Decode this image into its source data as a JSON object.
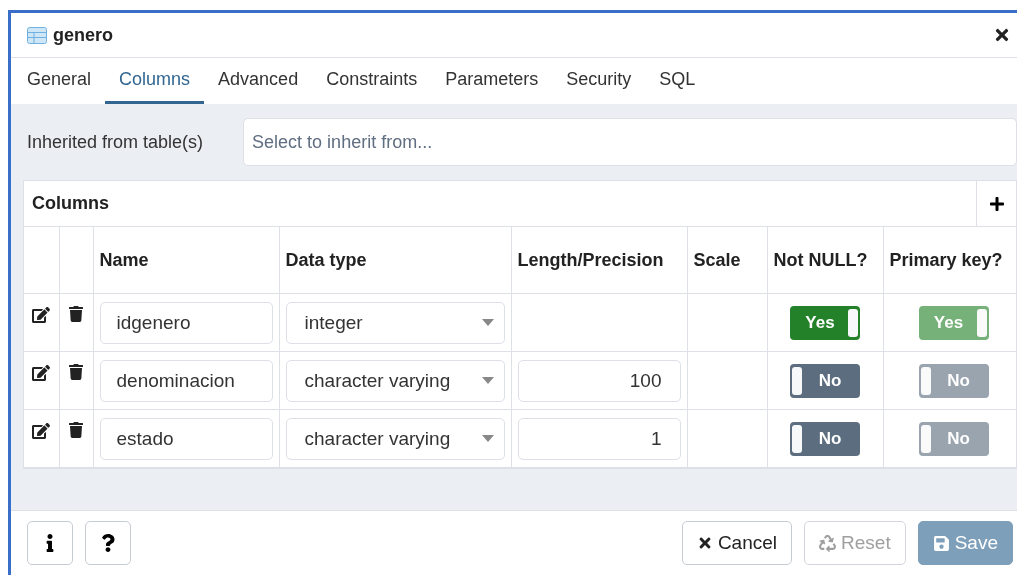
{
  "window": {
    "title": "genero"
  },
  "tabs": [
    {
      "label": "General",
      "selected": false
    },
    {
      "label": "Columns",
      "selected": true
    },
    {
      "label": "Advanced",
      "selected": false
    },
    {
      "label": "Constraints",
      "selected": false
    },
    {
      "label": "Parameters",
      "selected": false
    },
    {
      "label": "Security",
      "selected": false
    },
    {
      "label": "SQL",
      "selected": false
    }
  ],
  "inherit": {
    "label": "Inherited from table(s)",
    "placeholder": "Select to inherit from..."
  },
  "columns_panel": {
    "title": "Columns",
    "headers": [
      "Name",
      "Data type",
      "Length/Precision",
      "Scale",
      "Not NULL?",
      "Primary key?"
    ],
    "rows": [
      {
        "name": "idgenero",
        "data_type": "integer",
        "length": null,
        "not_null": {
          "on": true,
          "label": "Yes",
          "disabled": false
        },
        "primary_key": {
          "on": true,
          "label": "Yes",
          "disabled": true
        }
      },
      {
        "name": "denominacion",
        "data_type": "character varying",
        "length": "100",
        "not_null": {
          "on": false,
          "label": "No",
          "disabled": false
        },
        "primary_key": {
          "on": false,
          "label": "No",
          "disabled": true
        }
      },
      {
        "name": "estado",
        "data_type": "character varying",
        "length": "1",
        "not_null": {
          "on": false,
          "label": "No",
          "disabled": false
        },
        "primary_key": {
          "on": false,
          "label": "No",
          "disabled": true
        }
      }
    ]
  },
  "footer": {
    "buttons": [
      {
        "label": "Cancel",
        "kind": "cancel",
        "disabled": false
      },
      {
        "label": "Reset",
        "kind": "reset",
        "disabled": true
      },
      {
        "label": "Save",
        "kind": "save",
        "disabled": true
      }
    ]
  }
}
